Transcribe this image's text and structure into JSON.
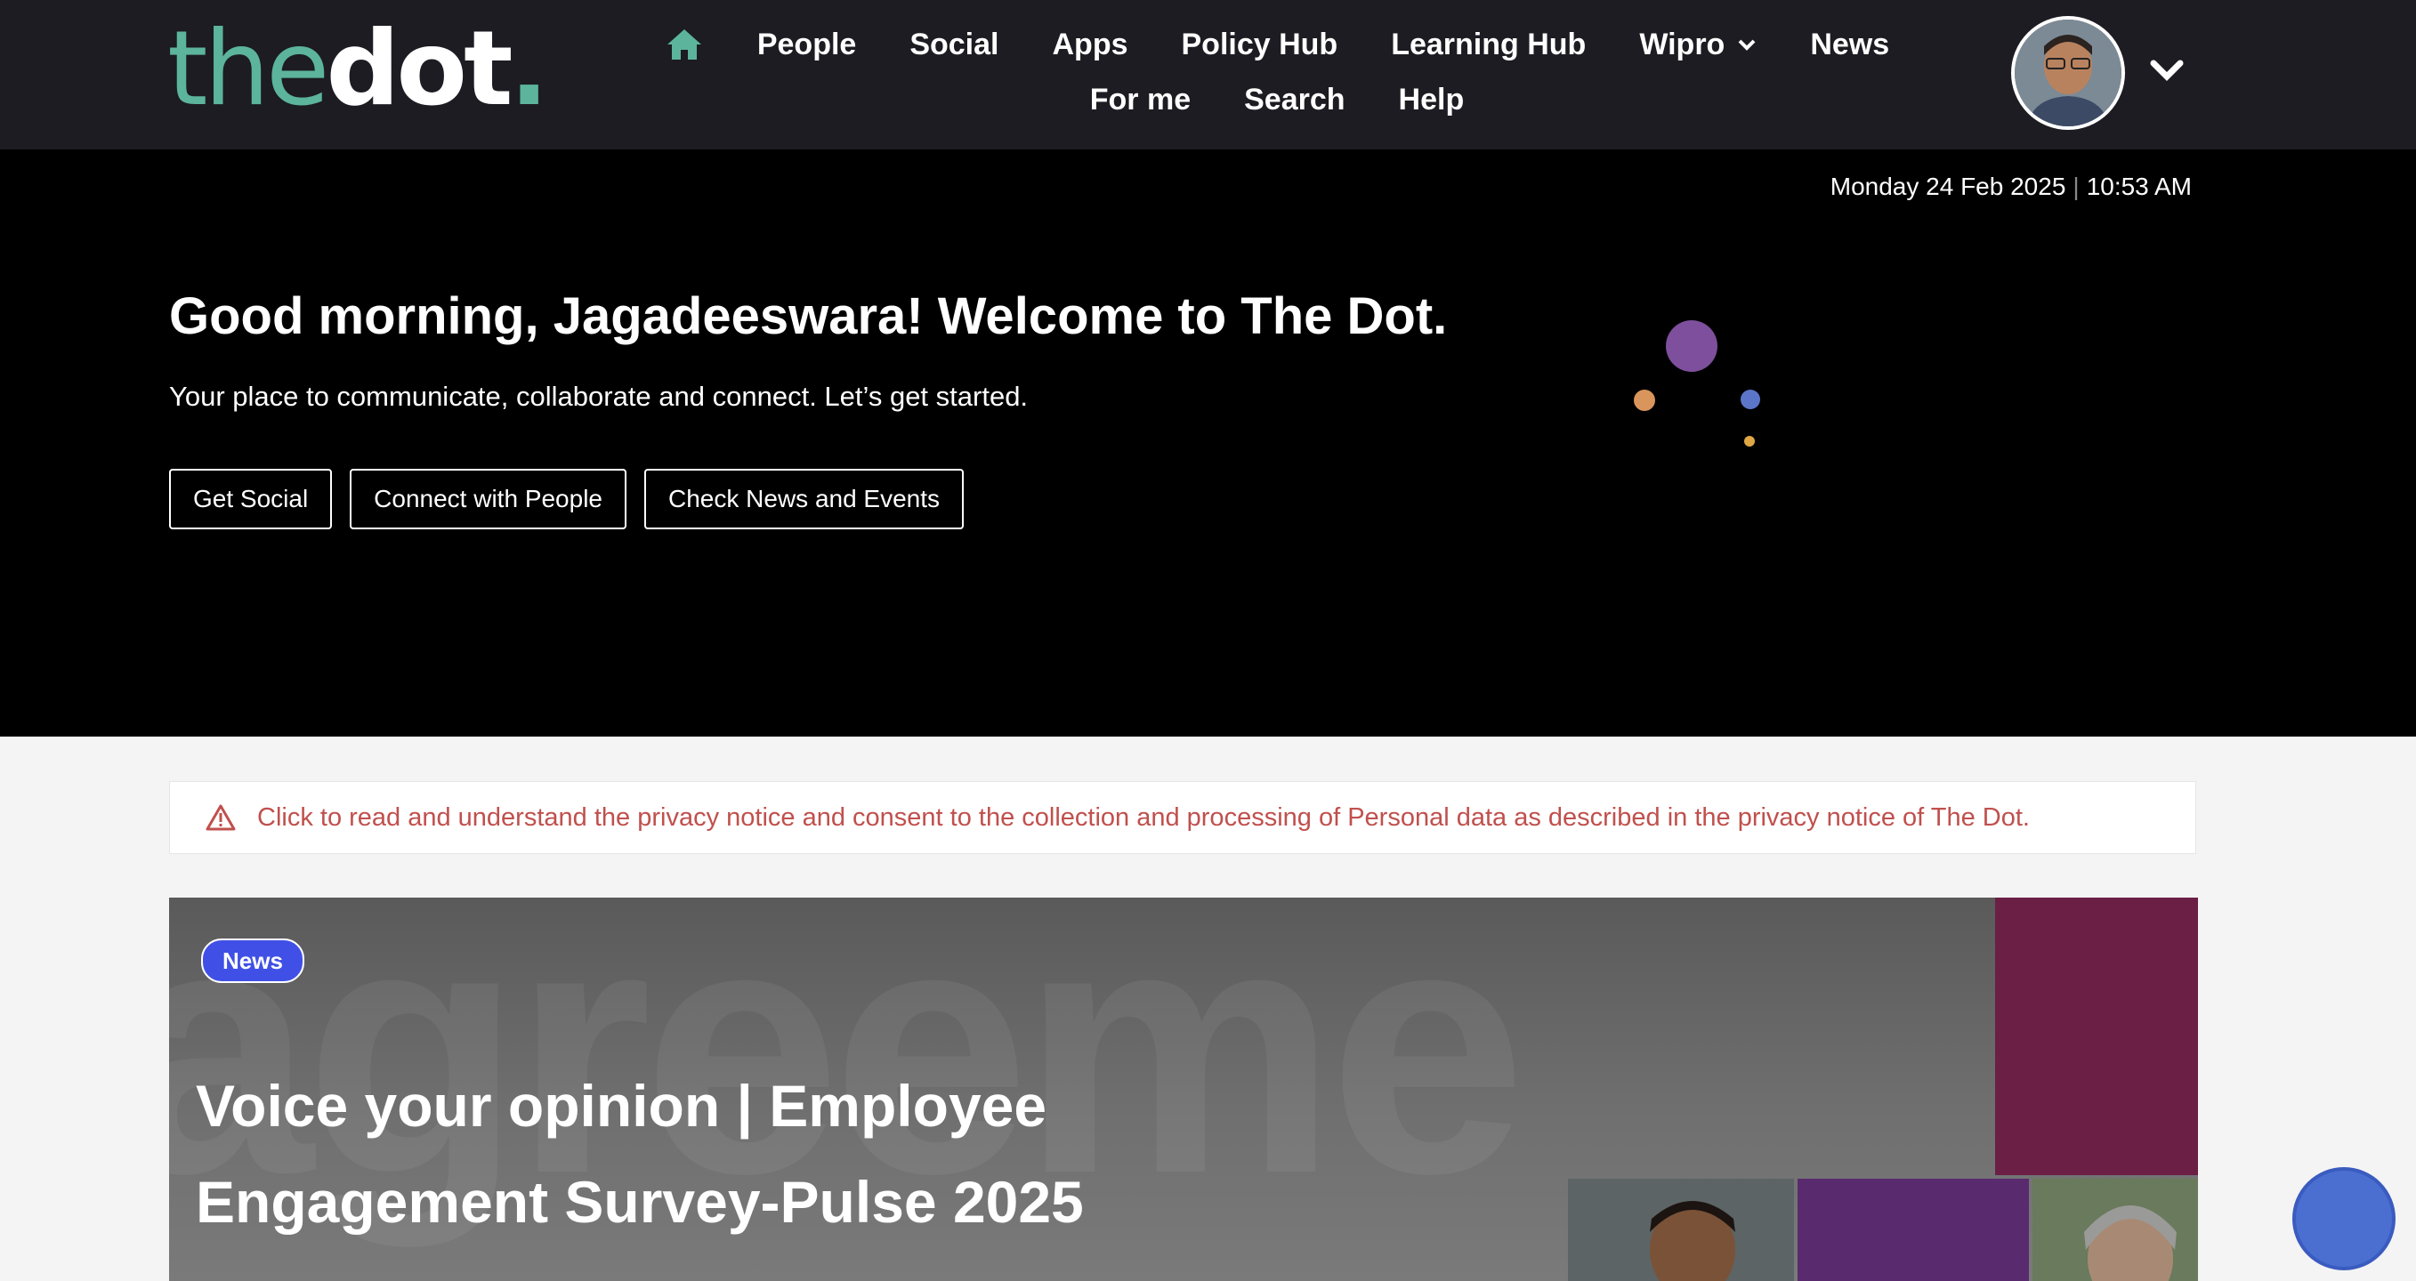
{
  "brand": {
    "logo_the": "the",
    "logo_dot": "dot",
    "logo_period": ".",
    "colors": {
      "teal": "#5cb49c",
      "header_bg": "#1c1c22",
      "notice_red": "#c0504d",
      "badge_blue": "#4050e6"
    }
  },
  "nav": {
    "home_icon": "home-icon",
    "items": [
      "People",
      "Social",
      "Apps",
      "Policy Hub",
      "Learning Hub",
      "Wipro",
      "News",
      "For me",
      "Search",
      "Help"
    ]
  },
  "user": {
    "avatar_icon": "user-avatar",
    "menu_icon": "chevron-down-icon"
  },
  "hero": {
    "date": "Monday 24 Feb 2025",
    "time": "10:53 AM",
    "greeting": "Good morning, Jagadeeswara! Welcome to The Dot.",
    "tagline": "Your place to communicate, collaborate and connect. Let’s get started.",
    "buttons": [
      "Get Social",
      "Connect with People",
      "Check News and Events"
    ]
  },
  "notice": {
    "icon": "warning-icon",
    "text": "Click to read and understand the privacy notice and consent to the collection and processing of Personal data as described in the privacy notice of The Dot."
  },
  "banner": {
    "badge": "News",
    "title_line1": "Voice your opinion | Employee",
    "title_line2": "Engagement Survey-Pulse 2025"
  }
}
